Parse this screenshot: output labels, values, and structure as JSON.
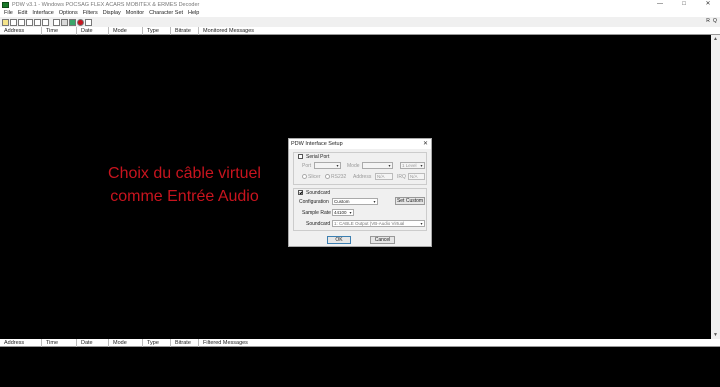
{
  "window": {
    "title": "PDW v3.1 - Windows POCSAG FLEX ACARS MOBITEX & ERMES Decoder",
    "minimize": "—",
    "maximize": "□",
    "close": "✕"
  },
  "menu": [
    "File",
    "Edit",
    "Interface",
    "Options",
    "Filters",
    "Display",
    "Monitor",
    "Character Set",
    "Help"
  ],
  "toolbar": {
    "right_buttons": [
      "R",
      "Q"
    ]
  },
  "top_pane": {
    "columns": [
      "Address",
      "Time",
      "Date",
      "Mode",
      "Type",
      "Bitrate",
      "Monitored Messages"
    ]
  },
  "bottom_pane": {
    "columns": [
      "Address",
      "Time",
      "Date",
      "Mode",
      "Type",
      "Bitrate",
      "Filtered Messages"
    ]
  },
  "annotation": {
    "line1": "Choix du câble virtuel",
    "line2": "comme Entrée Audio",
    "color": "#c8141e"
  },
  "dialog": {
    "title": "PDW Interface Setup",
    "close": "✕",
    "serial": {
      "label": "Serial Port",
      "checked": false,
      "port_label": "Port",
      "port_value": "",
      "mode_label": "Mode",
      "mode_value": "",
      "level_value": "1 Level",
      "slicer_label": "Slicer",
      "rs232_label": "RS232",
      "address_label": "Address",
      "address_value": "N/A",
      "irq_label": "IRQ",
      "irq_value": "N/A"
    },
    "soundcard": {
      "label": "Soundcard",
      "checked": true,
      "config_label": "Configuration",
      "config_value": "Custom",
      "set_custom_label": "Set Custom",
      "rate_label": "Sample Rate",
      "rate_value": "44100",
      "device_label": "Soundcard",
      "device_value": "1: CABLE Output (VB-Audio Virtual"
    },
    "ok_label": "OK",
    "cancel_label": "Cancel"
  }
}
